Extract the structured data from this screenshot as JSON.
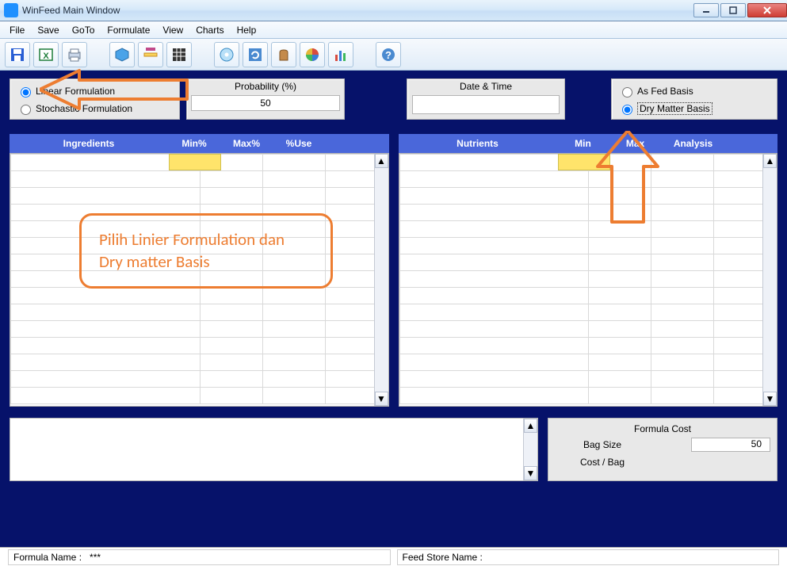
{
  "window": {
    "title": "WinFeed Main Window"
  },
  "menus": [
    "File",
    "Save",
    "GoTo",
    "Formulate",
    "View",
    "Charts",
    "Help"
  ],
  "toolbar_icons": [
    "save-icon",
    "export-excel-icon",
    "print-icon",
    "sep",
    "package-icon",
    "ruler-icon",
    "grid-icon",
    "sep",
    "disc-icon",
    "refresh-icon",
    "bag-icon",
    "piechart-icon",
    "barchart-icon",
    "sep",
    "help-icon"
  ],
  "formulation": {
    "linear_label": "Linear Formulation",
    "stochastic_label": "Stochastic Formulation"
  },
  "probability": {
    "label": "Probability (%)",
    "value": "50"
  },
  "datetime": {
    "label": "Date & Time",
    "value": ""
  },
  "basis": {
    "as_fed_label": "As Fed Basis",
    "dry_matter_label": "Dry Matter Basis"
  },
  "tables": {
    "left": {
      "headers": {
        "ing": "Ingredients",
        "min": "Min%",
        "max": "Max%",
        "use": "%Use"
      }
    },
    "right": {
      "headers": {
        "nut": "Nutrients",
        "min": "Min",
        "max": "Max",
        "ana": "Analysis"
      }
    }
  },
  "cost": {
    "title": "Formula Cost",
    "bag_label": "Bag  Size",
    "bag_value": "50",
    "costbag_label": "Cost / Bag",
    "costbag_value": ""
  },
  "status": {
    "formula_label": "Formula Name :",
    "formula_value": "***",
    "store_label": "Feed Store Name :",
    "store_value": ""
  },
  "annotation": {
    "text_line1": "Pilih Linier Formulation dan",
    "text_line2": "Dry matter Basis"
  },
  "annotation_color": "#ed7d31"
}
